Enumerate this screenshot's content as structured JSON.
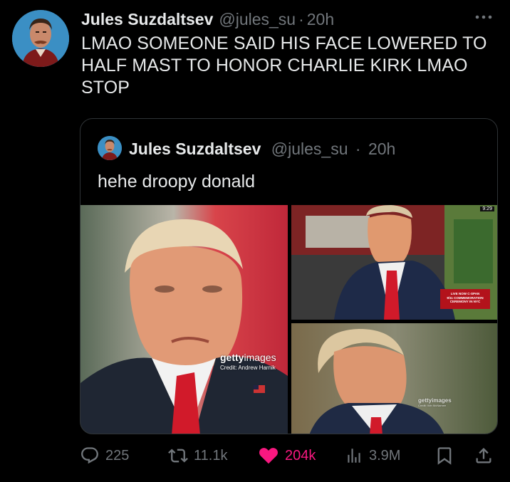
{
  "tweet": {
    "author_name": "Jules Suzdaltsev",
    "handle": "@jules_su",
    "separator": "·",
    "time": "20h",
    "text": "LMAO SOMEONE SAID HIS FACE LOWERED TO HALF MAST TO HONOR CHARLIE KIRK LMAO STOP"
  },
  "quoted": {
    "author_name": "Jules Suzdaltsev",
    "handle": "@jules_su",
    "separator": "·",
    "time": "20h",
    "text": "hehe droopy donald",
    "media": {
      "main_watermark_brand": "getty",
      "main_watermark_suffix": "images",
      "main_credit": "Credit: Andrew Harnik",
      "br_watermark": "gettyimages",
      "br_credit": "Credit: Win McNamee",
      "tv_clock": "9:29",
      "tv_banner_lines": [
        "LIVE NOW C-SPAN",
        "9/11 COMMEMORATION",
        "CEREMONY IN NYC"
      ]
    }
  },
  "actions": {
    "replies": "225",
    "reposts": "11.1k",
    "likes": "204k",
    "views": "3.9M"
  },
  "icons": {
    "more": "more-dots-icon",
    "reply": "reply-icon",
    "repost": "repost-icon",
    "like": "heart-filled-icon",
    "views": "views-chart-icon",
    "bookmark": "bookmark-icon",
    "share": "share-icon"
  },
  "colors": {
    "background": "#000000",
    "text": "#e7e9ea",
    "secondary": "#71767b",
    "like": "#f91880",
    "border": "#2f3336"
  }
}
